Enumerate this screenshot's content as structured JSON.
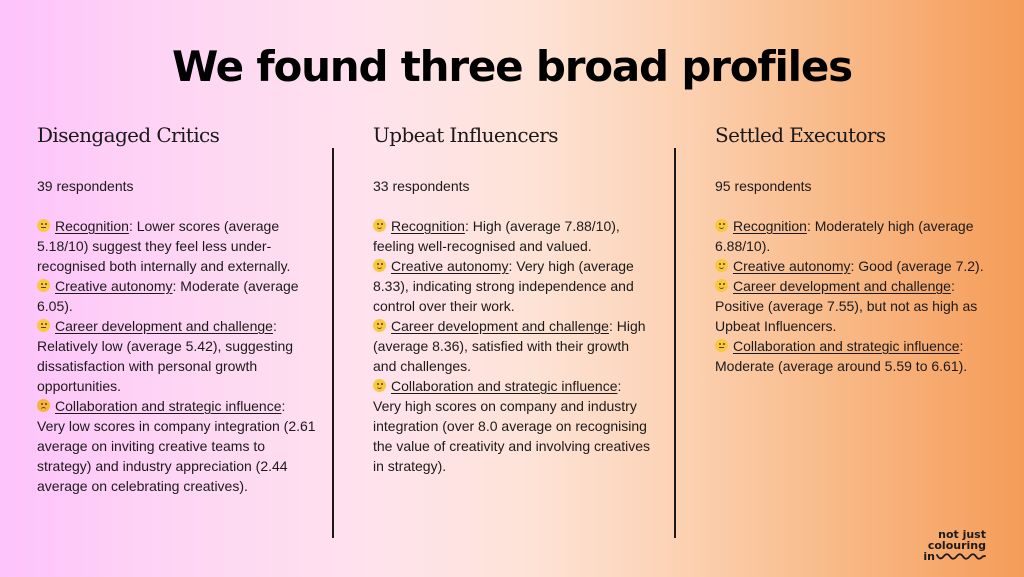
{
  "title": "We found three broad profiles",
  "profiles": [
    {
      "name": "Disengaged Critics",
      "respondents": "39 respondents",
      "items": [
        {
          "emoji": "neutral-face",
          "label": "Recognition",
          "text": ": Lower scores (average 5.18/10) suggest they feel less under-recognised both internally and externally."
        },
        {
          "emoji": "neutral-face",
          "label": "Creative autonomy",
          "text": ": Moderate (average 6.05)."
        },
        {
          "emoji": "neutral-face",
          "label": "Career development and challenge",
          "text": ": Relatively low (average 5.42), suggesting dissatisfaction with personal growth opportunities."
        },
        {
          "emoji": "disappointed-face",
          "label": "Collaboration and strategic influence",
          "text": ": Very low scores in company integration (2.61 average on inviting creative teams to strategy) and industry appreciation (2.44 average on celebrating creatives)."
        }
      ]
    },
    {
      "name": "Upbeat Influencers",
      "respondents": "33 respondents",
      "items": [
        {
          "emoji": "slightly-smiling-face",
          "label": "Recognition",
          "text": ": High (average 7.88/10), feeling well-recognised and valued."
        },
        {
          "emoji": "slightly-smiling-face",
          "label": "Creative autonomy",
          "text": ": Very high (average 8.33), indicating strong independence and control over their work."
        },
        {
          "emoji": "slightly-smiling-face",
          "label": "Career development and challenge",
          "text": ": High (average 8.36), satisfied with their growth and challenges."
        },
        {
          "emoji": "slightly-smiling-face",
          "label": "Collaboration and strategic influence",
          "text": ": Very high scores on company and industry integration (over 8.0 average on recognising the value of creativity and involving creatives in strategy)."
        }
      ]
    },
    {
      "name": "Settled Executors",
      "respondents": "95 respondents",
      "items": [
        {
          "emoji": "slightly-smiling-face",
          "label": "Recognition",
          "text": ": Moderately high (average 6.88/10)."
        },
        {
          "emoji": "slightly-smiling-face",
          "label": "Creative autonomy",
          "text": ": Good (average 7.2)."
        },
        {
          "emoji": "slightly-smiling-face",
          "label": "Career development and challenge",
          "text": ": Positive (average 7.55), but not as high as Upbeat Influencers."
        },
        {
          "emoji": "neutral-face",
          "label": "Collaboration and strategic influence",
          "text": ": Moderate (average around 5.59 to 6.61)."
        }
      ]
    }
  ],
  "logo": {
    "line1": "not just",
    "line2": "colouring",
    "line3": "in",
    "icon": "wave-icon"
  },
  "colors": {
    "gradient_left": "#fdc3fb",
    "gradient_mid": "#ffe3ec",
    "gradient_right": "#f59c58",
    "text": "#1c1a1a",
    "emoji": "#f8c93e"
  }
}
